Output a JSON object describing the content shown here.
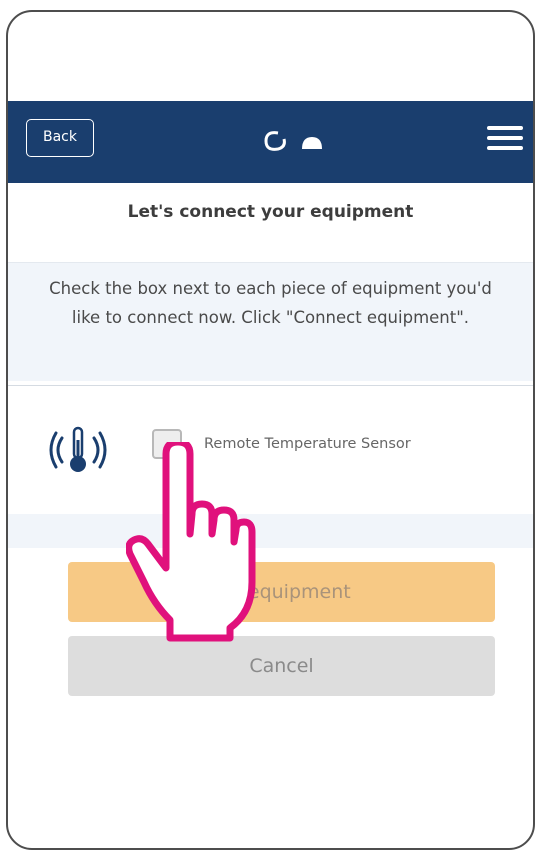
{
  "navbar": {
    "back_label": "Back",
    "logo_icon": "brand-logo-icon",
    "menu_icon": "hamburger-menu-icon",
    "background_color": "#1a3e6e"
  },
  "page": {
    "title": "Let's connect your equipment",
    "instructions_line1": "Check the box next to each piece of equipment you'd",
    "instructions_line2": "like to connect now. Click \"Connect equipment\"."
  },
  "equipment": [
    {
      "icon": "remote-temperature-sensor-icon",
      "label": "Remote Temperature Sensor",
      "checked": false
    }
  ],
  "actions": {
    "connect_label": "Connect equipment",
    "connect_visible_text": "ect equipment",
    "cancel_label": "Cancel",
    "connect_color": "#f7c985",
    "cancel_color": "#dddddd"
  },
  "overlay": {
    "pointer_icon": "hand-pointer-icon",
    "pointer_color": "#e0117c"
  }
}
